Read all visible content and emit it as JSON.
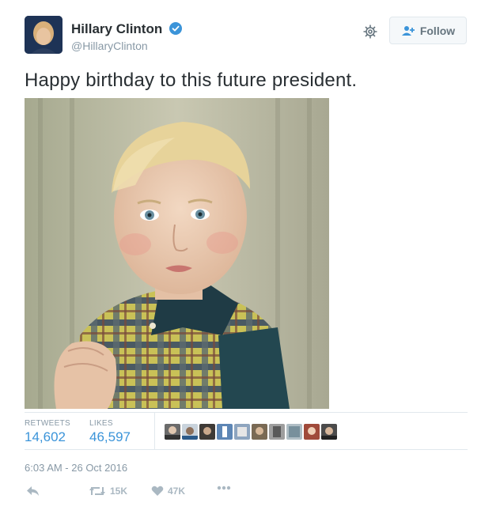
{
  "author": {
    "name": "Hillary Clinton",
    "handle": "@HillaryClinton",
    "verified": true
  },
  "header": {
    "follow_label": "Follow",
    "gear_icon": "gear-icon",
    "follow_icon": "add-user-icon"
  },
  "tweet": {
    "text": "Happy birthday to this future president."
  },
  "stats": {
    "retweets_label": "RETWEETS",
    "retweets_value": "14,602",
    "likes_label": "LIKES",
    "likes_value": "46,597",
    "liker_count": 10
  },
  "timestamp": "6:03 AM - 26 Oct 2016",
  "actions": {
    "reply_icon": "reply-icon",
    "retweet_icon": "retweet-icon",
    "retweet_count": "15K",
    "like_icon": "heart-icon",
    "like_count": "47K",
    "more_icon": "more-icon"
  },
  "colors": {
    "link_blue": "#3b94d9",
    "muted": "#8899a6",
    "text": "#292f33"
  }
}
